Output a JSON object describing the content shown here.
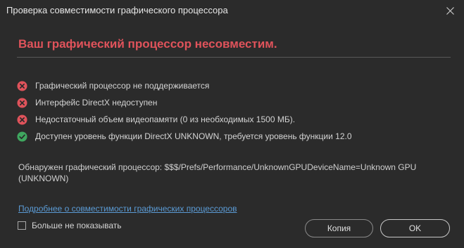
{
  "window": {
    "title": "Проверка совместимости графического процессора",
    "close_icon": "close-icon"
  },
  "heading": "Ваш графический процессор несовместим.",
  "colors": {
    "heading": "#e0535b",
    "fail": "#e0535b",
    "pass": "#3fa75f",
    "link": "#5b9bd5",
    "background": "#2b2b2b"
  },
  "checks": [
    {
      "status": "fail",
      "icon": "error-icon",
      "text": "Графический процессор не поддерживается"
    },
    {
      "status": "fail",
      "icon": "error-icon",
      "text": "Интерфейс DirectX недоступен"
    },
    {
      "status": "fail",
      "icon": "error-icon",
      "text": "Недостаточный объем видеопамяти (0 из необходимых 1500 МБ)."
    },
    {
      "status": "pass",
      "icon": "success-icon",
      "text": "Доступен уровень функции DirectX UNKNOWN, требуется уровень функции 12.0"
    }
  ],
  "detected_gpu": "Обнаружен графический процессор: $$$/Prefs/Performance/UnknownGPUDeviceName=Unknown GPU (UNKNOWN)",
  "link_text": "Подробнее о совместимости графических процессоров",
  "dont_show": {
    "label": "Больше не показывать",
    "checked": false
  },
  "buttons": {
    "copy": "Копия",
    "ok": "OK"
  }
}
